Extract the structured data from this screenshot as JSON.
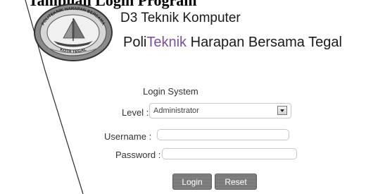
{
  "header": {
    "top_heading": "Tampilan Login Program",
    "line1": "D3 Teknik Komputer",
    "line2_prefix": "Poli",
    "line2_accent": "Teknik",
    "line2_suffix": " Harapan Bersama Tegal"
  },
  "logo": {
    "top_text": "POLITEKNIK HARAPAN BERSAMA",
    "bottom_text": "KOTA TEGAL",
    "icon": "ship-emblem-icon"
  },
  "login": {
    "title": "Login System",
    "level_label": "Level :",
    "level_value": "Administrator",
    "username_label": "Username :",
    "username_value": "",
    "password_label": "Password :",
    "password_value": "",
    "login_button": "Login",
    "reset_button": "Reset"
  },
  "colors": {
    "accent": "#7a4f9c",
    "button": "#6b6b6b"
  }
}
